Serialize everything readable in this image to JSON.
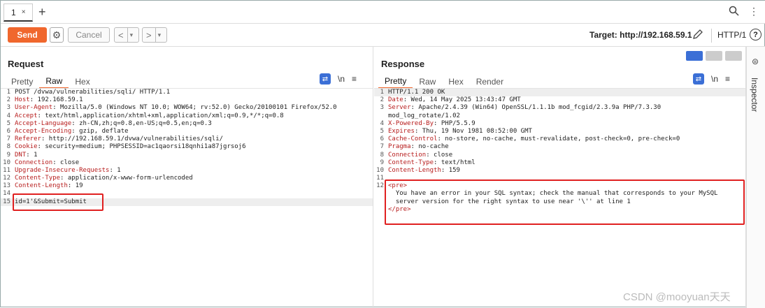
{
  "tabs": [
    {
      "label": "1",
      "close": "×"
    }
  ],
  "new_tab": "+",
  "toolbar": {
    "send": "Send",
    "cancel": "Cancel",
    "back": "<",
    "back_dd": "▾",
    "fwd": ">",
    "fwd_dd": "▾",
    "target": "Target: http://192.168.59.1",
    "protocol": "HTTP/1",
    "help": "?"
  },
  "request": {
    "title": "Request",
    "tabs": [
      "Pretty",
      "Raw",
      "Hex"
    ],
    "active_tab": "Raw",
    "tools": {
      "newline": "\\n",
      "menu": "≡"
    },
    "lines": [
      {
        "n": "1",
        "name": "",
        "value": "POST /dvwa/vulnerabilities/sqli/ HTTP/1.1"
      },
      {
        "n": "2",
        "name": "Host",
        "value": " 192.168.59.1"
      },
      {
        "n": "3",
        "name": "User-Agent",
        "value": " Mozilla/5.0 (Windows NT 10.0; WOW64; rv:52.0) Gecko/20100101 Firefox/52.0"
      },
      {
        "n": "4",
        "name": "Accept",
        "value": " text/html,application/xhtml+xml,application/xml;q=0.9,*/*;q=0.8"
      },
      {
        "n": "5",
        "name": "Accept-Language",
        "value": " zh-CN,zh;q=0.8,en-US;q=0.5,en;q=0.3"
      },
      {
        "n": "6",
        "name": "Accept-Encoding",
        "value": " gzip, deflate"
      },
      {
        "n": "7",
        "name": "Referer",
        "value": " http://192.168.59.1/dvwa/vulnerabilities/sqli/"
      },
      {
        "n": "8",
        "name": "Cookie",
        "value": " security=medium; PHPSESSID=ac1qaorsi18qnhi1a87jgrsoj6"
      },
      {
        "n": "9",
        "name": "DNT",
        "value": " 1"
      },
      {
        "n": "10",
        "name": "Connection",
        "value": " close"
      },
      {
        "n": "11",
        "name": "Upgrade-Insecure-Requests",
        "value": " 1"
      },
      {
        "n": "12",
        "name": "Content-Type",
        "value": " application/x-www-form-urlencoded"
      },
      {
        "n": "13",
        "name": "Content-Length",
        "value": " 19"
      },
      {
        "n": "14",
        "name": "",
        "value": ""
      },
      {
        "n": "15",
        "name": "",
        "value": "id=1'&Submit=Submit"
      }
    ]
  },
  "response": {
    "title": "Response",
    "tabs": [
      "Pretty",
      "Raw",
      "Hex",
      "Render"
    ],
    "active_tab": "Pretty",
    "tools": {
      "newline": "\\n",
      "menu": "≡"
    },
    "lines": [
      {
        "n": "1",
        "name": "",
        "value": "HTTP/1.1 200 OK"
      },
      {
        "n": "2",
        "name": "Date",
        "value": " Wed, 14 May 2025 13:43:47 GMT"
      },
      {
        "n": "3",
        "name": "Server",
        "value": " Apache/2.4.39 (Win64) OpenSSL/1.1.1b mod_fcgid/2.3.9a PHP/7.3.30"
      },
      {
        "n": "",
        "name": "",
        "value": "mod_log_rotate/1.02"
      },
      {
        "n": "4",
        "name": "X-Powered-By",
        "value": " PHP/5.5.9"
      },
      {
        "n": "5",
        "name": "Expires",
        "value": " Thu, 19 Nov 1981 08:52:00 GMT"
      },
      {
        "n": "6",
        "name": "Cache-Control",
        "value": " no-store, no-cache, must-revalidate, post-check=0, pre-check=0"
      },
      {
        "n": "7",
        "name": "Pragma",
        "value": " no-cache"
      },
      {
        "n": "8",
        "name": "Connection",
        "value": " close"
      },
      {
        "n": "9",
        "name": "Content-Type",
        "value": " text/html"
      },
      {
        "n": "10",
        "name": "Content-Length",
        "value": " 159"
      },
      {
        "n": "11",
        "name": "",
        "value": ""
      },
      {
        "n": "12",
        "name": "",
        "value": "<pre>"
      },
      {
        "n": "",
        "name": "",
        "value": "  You have an error in your SQL syntax; check the manual that corresponds to your MySQL"
      },
      {
        "n": "",
        "name": "",
        "value": "  server version for the right syntax to use near '\\'' at line 1"
      },
      {
        "n": "",
        "name": "",
        "value": "</pre>"
      }
    ]
  },
  "inspector": {
    "label": "Inspector"
  },
  "watermark": "CSDN @mooyuan天天",
  "colors": {
    "accent": "#f0672d",
    "blue": "#3b6fd6",
    "highlight": "#e02020"
  }
}
